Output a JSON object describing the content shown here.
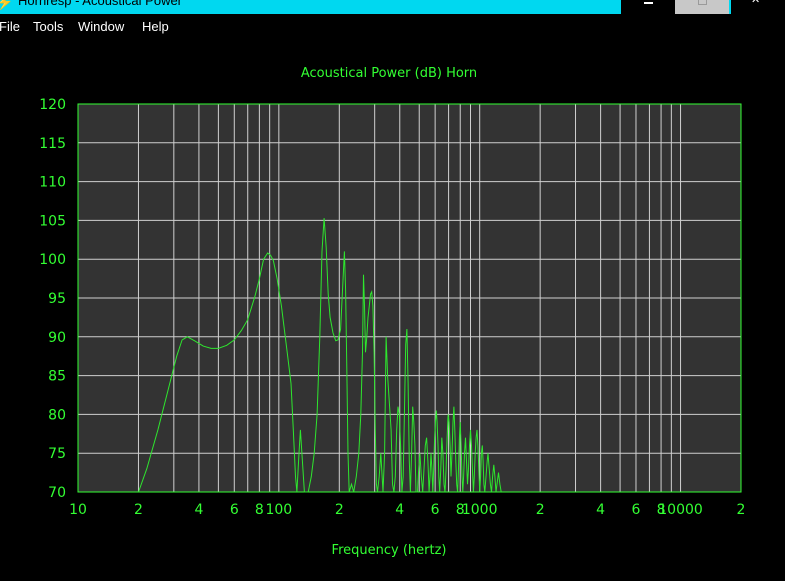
{
  "window": {
    "title": "Hornresp - Acoustical Power",
    "app_icon": "lightning-icon",
    "controls": [
      "minimize-icon",
      "maximize-icon",
      "close-icon"
    ]
  },
  "menu": {
    "items": [
      "File",
      "Tools",
      "Window",
      "Help"
    ]
  },
  "colors": {
    "background": "#000000",
    "plot_bg": "#333333",
    "grid": "#d0d0d0",
    "text": "#33ff33",
    "curve": "#2ee62e",
    "titlebar": "#00d8f0"
  },
  "chart_data": {
    "type": "line",
    "title": "Acoustical Power (dB)   Horn",
    "xlabel": "Frequency (hertz)",
    "ylabel": "",
    "x_scale": "log",
    "xlim": [
      10,
      20000
    ],
    "ylim": [
      70,
      120
    ],
    "grid": true,
    "y_ticks": [
      70,
      75,
      80,
      85,
      90,
      95,
      100,
      105,
      110,
      115,
      120
    ],
    "x_tick_labels": [
      {
        "value": 10,
        "label": "10"
      },
      {
        "value": 20,
        "label": "2"
      },
      {
        "value": 40,
        "label": "4"
      },
      {
        "value": 60,
        "label": "6"
      },
      {
        "value": 80,
        "label": "8"
      },
      {
        "value": 100,
        "label": "100"
      },
      {
        "value": 200,
        "label": "2"
      },
      {
        "value": 400,
        "label": "4"
      },
      {
        "value": 600,
        "label": "6"
      },
      {
        "value": 800,
        "label": "8"
      },
      {
        "value": 1000,
        "label": "1000"
      },
      {
        "value": 2000,
        "label": "2"
      },
      {
        "value": 4000,
        "label": "4"
      },
      {
        "value": 6000,
        "label": "6"
      },
      {
        "value": 8000,
        "label": "8"
      },
      {
        "value": 10000,
        "label": "10000"
      },
      {
        "value": 20000,
        "label": "2"
      }
    ],
    "series": [
      {
        "points": [
          [
            20,
            70
          ],
          [
            22,
            73
          ],
          [
            25,
            78
          ],
          [
            28,
            83
          ],
          [
            31,
            87.5
          ],
          [
            33,
            89.6
          ],
          [
            35,
            90
          ],
          [
            38,
            89.5
          ],
          [
            42,
            88.8
          ],
          [
            46,
            88.5
          ],
          [
            50,
            88.5
          ],
          [
            55,
            88.9
          ],
          [
            60,
            89.6
          ],
          [
            65,
            90.8
          ],
          [
            70,
            92.2
          ],
          [
            76,
            95.2
          ],
          [
            80,
            97.5
          ],
          [
            84,
            100
          ],
          [
            88,
            100.8
          ],
          [
            91,
            100.5
          ],
          [
            94,
            99.8
          ],
          [
            98,
            97.5
          ],
          [
            103,
            94
          ],
          [
            110,
            88
          ],
          [
            115,
            84
          ],
          [
            118,
            78
          ],
          [
            121,
            72
          ],
          [
            123,
            70
          ],
          [
            126,
            75
          ],
          [
            128,
            78
          ],
          [
            131,
            74
          ],
          [
            134,
            70
          ],
          [
            140,
            70
          ],
          [
            145,
            72
          ],
          [
            150,
            75
          ],
          [
            155,
            80
          ],
          [
            160,
            90
          ],
          [
            164,
            101
          ],
          [
            168,
            105.3
          ],
          [
            172,
            101.5
          ],
          [
            176,
            95.5
          ],
          [
            180,
            92.5
          ],
          [
            186,
            90.5
          ],
          [
            192,
            89.5
          ],
          [
            197,
            89.6
          ],
          [
            203,
            91
          ],
          [
            208,
            96.5
          ],
          [
            212,
            101
          ],
          [
            215,
            96
          ],
          [
            218,
            86
          ],
          [
            221,
            75
          ],
          [
            224,
            70
          ],
          [
            230,
            71
          ],
          [
            236,
            70
          ],
          [
            243,
            72
          ],
          [
            250,
            75
          ],
          [
            256,
            80
          ],
          [
            261,
            88
          ],
          [
            264,
            98
          ],
          [
            267,
            94
          ],
          [
            270,
            88
          ],
          [
            274,
            90
          ],
          [
            278,
            92.5
          ],
          [
            282,
            94
          ],
          [
            286,
            95.5
          ],
          [
            290,
            95.8
          ],
          [
            294,
            94
          ],
          [
            298,
            88
          ],
          [
            302,
            78
          ],
          [
            306,
            71
          ],
          [
            310,
            70
          ],
          [
            316,
            72
          ],
          [
            322,
            75
          ],
          [
            330,
            70
          ],
          [
            336,
            75
          ],
          [
            342,
            90
          ],
          [
            348,
            85
          ],
          [
            354,
            82
          ],
          [
            362,
            78
          ],
          [
            368,
            71
          ],
          [
            374,
            70
          ],
          [
            380,
            72
          ],
          [
            386,
            78
          ],
          [
            392,
            81
          ],
          [
            398,
            80
          ],
          [
            404,
            76
          ],
          [
            410,
            70
          ],
          [
            416,
            72
          ],
          [
            422,
            80
          ],
          [
            428,
            89
          ],
          [
            434,
            91
          ],
          [
            440,
            84
          ],
          [
            446,
            74
          ],
          [
            452,
            70
          ],
          [
            458,
            75
          ],
          [
            464,
            81
          ],
          [
            470,
            79
          ],
          [
            476,
            76
          ],
          [
            482,
            70
          ],
          [
            490,
            70
          ],
          [
            497,
            73
          ],
          [
            504,
            75
          ],
          [
            512,
            72
          ],
          [
            520,
            70
          ],
          [
            528,
            73
          ],
          [
            536,
            76
          ],
          [
            544,
            77
          ],
          [
            552,
            74
          ],
          [
            560,
            70
          ],
          [
            566,
            72
          ],
          [
            572,
            75
          ],
          [
            578,
            73
          ],
          [
            584,
            70
          ],
          [
            590,
            73
          ],
          [
            596,
            77
          ],
          [
            602,
            79
          ],
          [
            608,
            80.5
          ],
          [
            614,
            79
          ],
          [
            620,
            76
          ],
          [
            626,
            72
          ],
          [
            632,
            70
          ],
          [
            640,
            73
          ],
          [
            648,
            77
          ],
          [
            656,
            75
          ],
          [
            664,
            71
          ],
          [
            672,
            70
          ],
          [
            680,
            73
          ],
          [
            688,
            77
          ],
          [
            696,
            80
          ],
          [
            704,
            79
          ],
          [
            712,
            76
          ],
          [
            720,
            72
          ],
          [
            728,
            75
          ],
          [
            736,
            79
          ],
          [
            744,
            81
          ],
          [
            752,
            78
          ],
          [
            760,
            74
          ],
          [
            768,
            71
          ],
          [
            776,
            70
          ],
          [
            784,
            73
          ],
          [
            792,
            77
          ],
          [
            800,
            79
          ],
          [
            808,
            76
          ],
          [
            816,
            72
          ],
          [
            824,
            70
          ],
          [
            832,
            72
          ],
          [
            840,
            75
          ],
          [
            850,
            77
          ],
          [
            860,
            74
          ],
          [
            870,
            71
          ],
          [
            880,
            73
          ],
          [
            890,
            76
          ],
          [
            900,
            78
          ],
          [
            910,
            76
          ],
          [
            920,
            73
          ],
          [
            930,
            70
          ],
          [
            940,
            72
          ],
          [
            950,
            75
          ],
          [
            960,
            77
          ],
          [
            970,
            78
          ],
          [
            980,
            76
          ],
          [
            990,
            73
          ],
          [
            1000,
            70
          ],
          [
            1010,
            72
          ],
          [
            1020,
            75
          ],
          [
            1030,
            76
          ],
          [
            1040,
            74
          ],
          [
            1050,
            71
          ],
          [
            1060,
            70
          ],
          [
            1075,
            72
          ],
          [
            1090,
            74
          ],
          [
            1100,
            75
          ],
          [
            1115,
            73
          ],
          [
            1130,
            71
          ],
          [
            1145,
            70
          ],
          [
            1160,
            72
          ],
          [
            1175,
            73.5
          ],
          [
            1190,
            72
          ],
          [
            1205,
            70
          ],
          [
            1220,
            71
          ],
          [
            1240,
            72.5
          ],
          [
            1260,
            71
          ],
          [
            1280,
            70
          ]
        ]
      }
    ]
  }
}
